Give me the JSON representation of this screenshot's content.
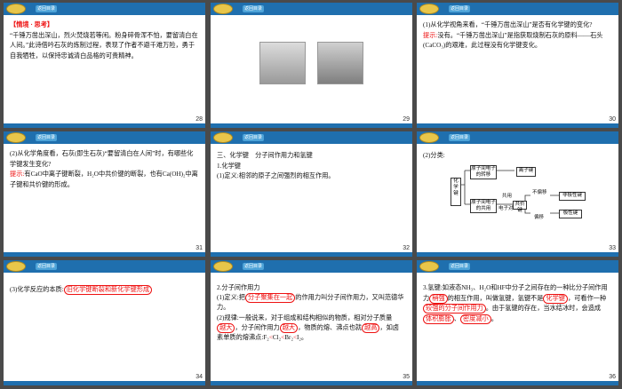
{
  "header": {
    "back_label": "返回目录"
  },
  "slides": [
    {
      "page": "28",
      "tag": "【情境 · 思考】",
      "body": "“千锤万凿出深山，烈火焚烧若等闲。粉身碎骨浑不怕，要留清白在人间。”此诗借吟石灰的炼制过程，表现了作者不避千难万险，勇于自我牺牲，以保持忠诚清白品格的可贵精神。"
    },
    {
      "page": "29"
    },
    {
      "page": "30",
      "q": "(1)从化学视角来看，“千锤万凿出深山”是否有化学键的变化?",
      "tip_label": "提示:",
      "tip_text": "没有。“千锤万凿出深山”是指获取烧制石灰的原料——石头(CaCO₃)的艰难，此过程没有化学键变化。"
    },
    {
      "page": "31",
      "q": "(2)从化学角度看，石灰(即生石灰)“要留清白在人间”时，有哪些化学键发生变化?",
      "tip_label": "提示:",
      "tip_text": "有CaO中离子键断裂，H₂O中共价键的断裂，也有Ca(OH)₂中离子键和共价键的形成。"
    },
    {
      "page": "32",
      "title": "三、化学键　分子间作用力和氢键",
      "sub": "1.化学键",
      "def": "(1)定义:相邻的原子之间强烈的相互作用。"
    },
    {
      "page": "33",
      "title": "(2)分类:",
      "diagram": {
        "root": "化学键",
        "b1": "原子间电子的转移",
        "b2": "原子间电子的共用",
        "ion": "离子键",
        "shared": "共用",
        "cov": "共价键",
        "pair": "电子对",
        "nonpolar_pre": "不偏移",
        "nonpolar": "非极性键",
        "polar_pre": "偏移",
        "polar": "极性键"
      }
    },
    {
      "page": "34",
      "text": "(3)化学反应的本质:",
      "fill": "旧化学键断裂和新化学键形成"
    },
    {
      "page": "35",
      "title": "2.分子间作用力",
      "l1a": "(1)定义:把",
      "fill1": "分子聚集在一起",
      "l1b": "的作用力叫分子间作用力，又叫范德华力。",
      "l2": "(2)规律:一般说来，对于组成和结构相似的物质，相对分子质量",
      "fill2": "越大",
      "l3": "，分子间作用力",
      "fill3": "越大",
      "l4": "，物质的熔、沸点也就",
      "fill4": "越高",
      "l5": "，如卤素单质的熔沸点:F₂",
      "cmp": "<",
      "l6": "Cl₂",
      "l7": "Br₂",
      "l8": "I₂。"
    },
    {
      "page": "36",
      "l1": "3.氢键:如液态NH₃、H₂O和HF中分子之间存在的一种比分子间作用力",
      "fill1": "稍强",
      "l2": "的相互作用，叫做氢键，氢键不是",
      "fill2": "化学键",
      "l3": "，可看作一种",
      "fill3": "较强的分子间作用力",
      "l4": "。由于氢键的存在，当水结冰时，会造成",
      "fill4": "体积膨胀",
      "fill5": "密度减小",
      "l5": "。"
    }
  ]
}
